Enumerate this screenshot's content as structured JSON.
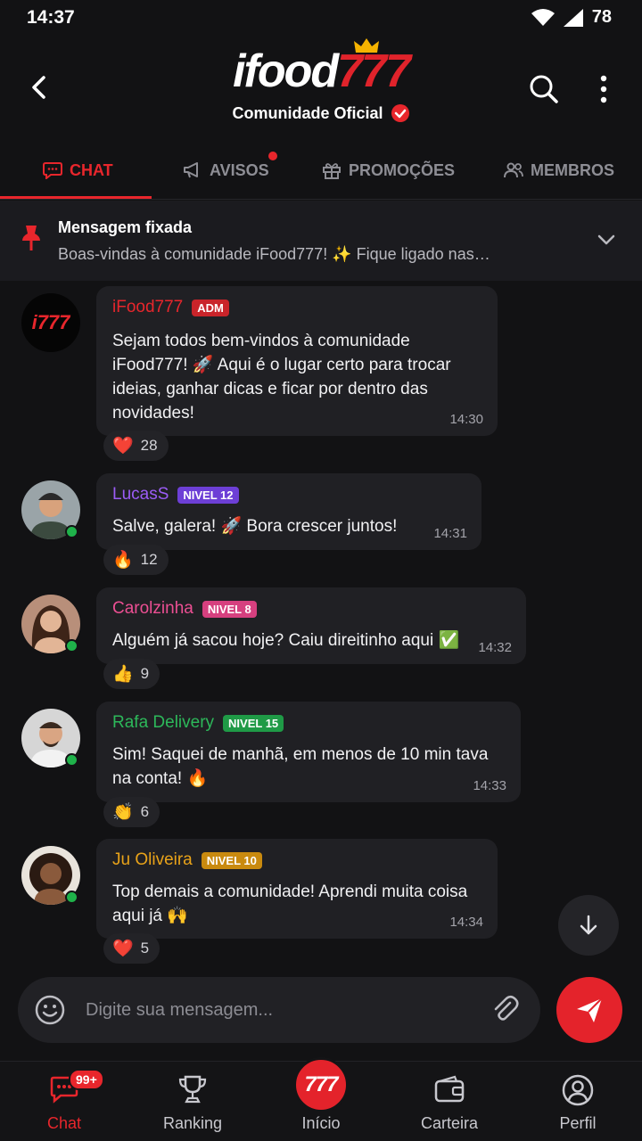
{
  "status_bar": {
    "time": "14:37",
    "battery": "78"
  },
  "header": {
    "logo_part1": "ifood",
    "logo_part2": "777",
    "subtitle": "Comunidade Oficial"
  },
  "tabs": [
    {
      "label": "CHAT",
      "active": true
    },
    {
      "label": "AVISOS",
      "has_dot": true
    },
    {
      "label": "PROMOÇÕES"
    },
    {
      "label": "MEMBROS"
    }
  ],
  "pinned": {
    "title": "Mensagem fixada",
    "text": "Boas-vindas à comunidade iFood777! ✨ Fique ligado nas…"
  },
  "messages": [
    {
      "name": "iFood777",
      "badge": "ADM",
      "avatar_text": "i777",
      "text": "Sejam todos bem-vindos à comunidade iFood777! 🚀 Aqui é o lugar certo para trocar ideias, ganhar dicas e ficar por dentro das novidades!",
      "time": "14:30",
      "reaction_emoji": "❤️",
      "reaction_count": "28",
      "name_color": "#e8262c",
      "badge_color": "#c9242a"
    },
    {
      "name": "LucasS",
      "badge": "NIVEL 12",
      "text": "Salve, galera! 🚀 Bora crescer juntos!",
      "time": "14:31",
      "reaction_emoji": "🔥",
      "reaction_count": "12",
      "name_color": "#9b5cf6",
      "badge_color": "#6d3fd6"
    },
    {
      "name": "Carolzinha",
      "badge": "NIVEL 8",
      "text": "Alguém já sacou hoje? Caiu direitinho aqui ✅",
      "time": "14:32",
      "reaction_emoji": "👍",
      "reaction_count": "9",
      "name_color": "#ec4f93",
      "badge_color": "#d6407f"
    },
    {
      "name": "Rafa Delivery",
      "badge": "NIVEL 15",
      "text": "Sim! Saquei de manhã, em menos de 10 min tava na conta! 🔥",
      "time": "14:33",
      "reaction_emoji": "👏",
      "reaction_count": "6",
      "name_color": "#2db85a",
      "badge_color": "#1f9a46"
    },
    {
      "name": "Ju Oliveira",
      "badge": "NIVEL 10",
      "text": "Top demais a comunidade! Aprendi muita coisa aqui já 🙌",
      "time": "14:34",
      "reaction_emoji": "❤️",
      "reaction_count": "5",
      "name_color": "#e9a319",
      "badge_color": "#c98a0f"
    }
  ],
  "composer": {
    "placeholder": "Digite sua mensagem..."
  },
  "bottom_nav": [
    {
      "label": "Chat",
      "active": true,
      "badge": "99+"
    },
    {
      "label": "Ranking"
    },
    {
      "label": "Início",
      "icon_text": "777"
    },
    {
      "label": "Carteira"
    },
    {
      "label": "Perfil"
    }
  ]
}
